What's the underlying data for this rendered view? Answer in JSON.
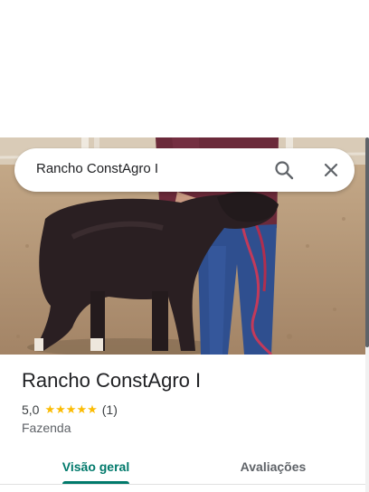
{
  "search": {
    "query": "Rancho ConstAgro I"
  },
  "place": {
    "title": "Rancho ConstAgro I",
    "rating": "5,0",
    "stars": 5,
    "review_count": "(1)",
    "category": "Fazenda"
  },
  "tabs": [
    {
      "label": "Visão geral",
      "selected": true
    },
    {
      "label": "Avaliações",
      "selected": false
    }
  ],
  "icons": {
    "search": "search-icon",
    "close": "close-icon",
    "star": "star-icon"
  },
  "colors": {
    "accent": "#00796b",
    "star": "#fbbc04",
    "text_primary": "#202124",
    "text_secondary": "#5f6368"
  }
}
